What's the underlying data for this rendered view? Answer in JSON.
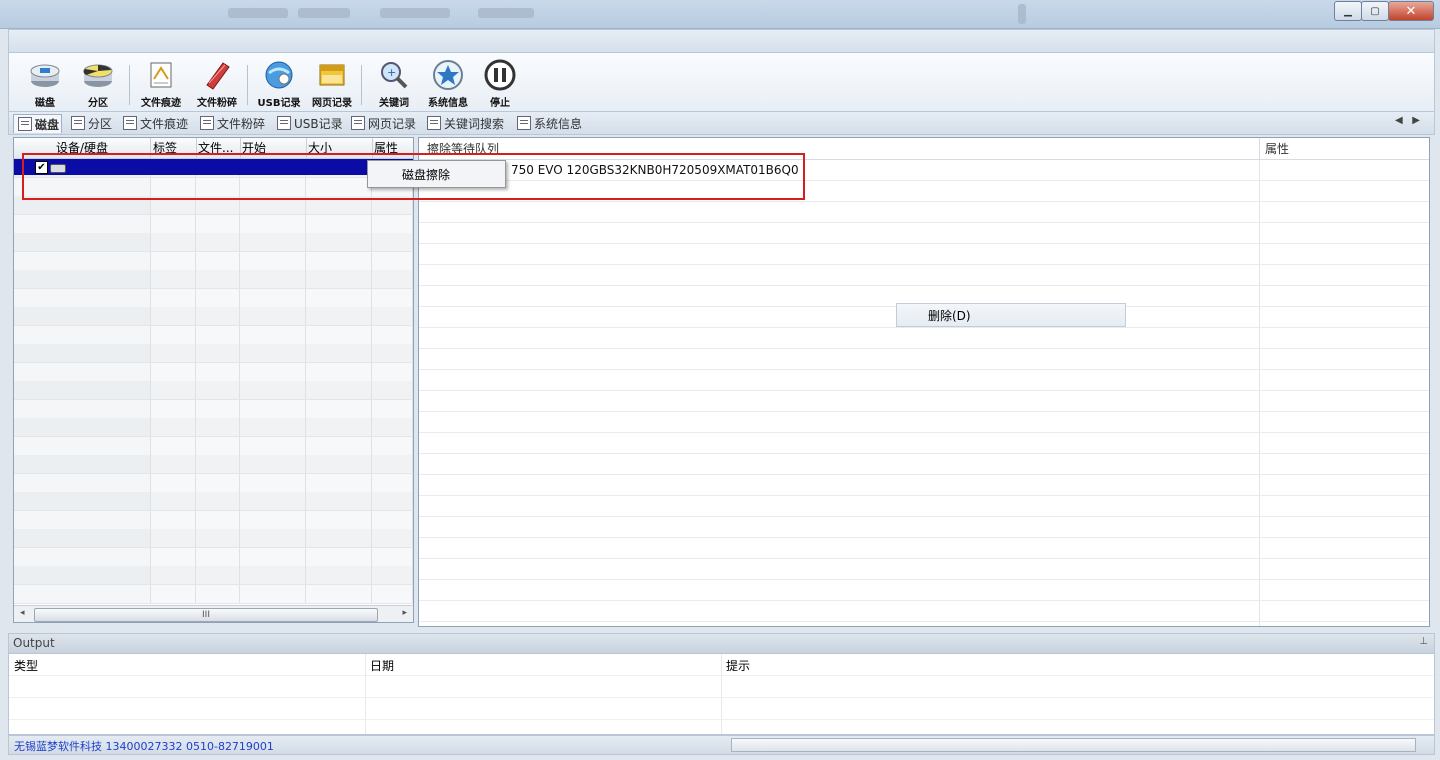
{
  "titlebar": {
    "blurred_tabs": [
      "",
      "",
      ""
    ]
  },
  "toolbar": {
    "buttons": [
      {
        "label": "磁盘",
        "icon": "disk-icon"
      },
      {
        "label": "分区",
        "icon": "partition-icon"
      },
      {
        "label": "文件痕迹",
        "icon": "file-trace-icon"
      },
      {
        "label": "文件粉碎",
        "icon": "file-shred-icon"
      },
      {
        "label": "USB记录",
        "icon": "usb-record-icon"
      },
      {
        "label": "网页记录",
        "icon": "web-record-icon"
      },
      {
        "label": "关键词",
        "icon": "keyword-search-icon"
      },
      {
        "label": "系统信息",
        "icon": "system-info-icon"
      },
      {
        "label": "停止",
        "icon": "pause-icon"
      }
    ]
  },
  "tabs": [
    {
      "label": "磁盘",
      "active": true
    },
    {
      "label": "分区"
    },
    {
      "label": "文件痕迹"
    },
    {
      "label": "文件粉碎"
    },
    {
      "label": "USB记录"
    },
    {
      "label": "网页记录"
    },
    {
      "label": "关键词搜索"
    },
    {
      "label": "系统信息"
    }
  ],
  "left_table": {
    "columns": [
      "设备/硬盘",
      "标签",
      "文件...",
      "开始",
      "大小",
      "属性"
    ],
    "scroll_thumb": "III"
  },
  "right_table": {
    "columns": [
      "擦除等待队列",
      "属性"
    ],
    "queue_item": "750 EVO 120GBS32KNB0H720509XMAT01B6Q0"
  },
  "context_menu_left": {
    "item": "磁盘擦除"
  },
  "context_menu_right": {
    "item": "删除(D)"
  },
  "output": {
    "title": "Output",
    "columns": [
      "类型",
      "日期",
      "提示"
    ]
  },
  "status": {
    "text": "无锡蓝梦软件科技 13400027332  0510-82719001"
  },
  "colors": {
    "selection": "#0b0ba6",
    "highlight_box": "#d81d1d",
    "status_text": "#1f3fcc"
  }
}
